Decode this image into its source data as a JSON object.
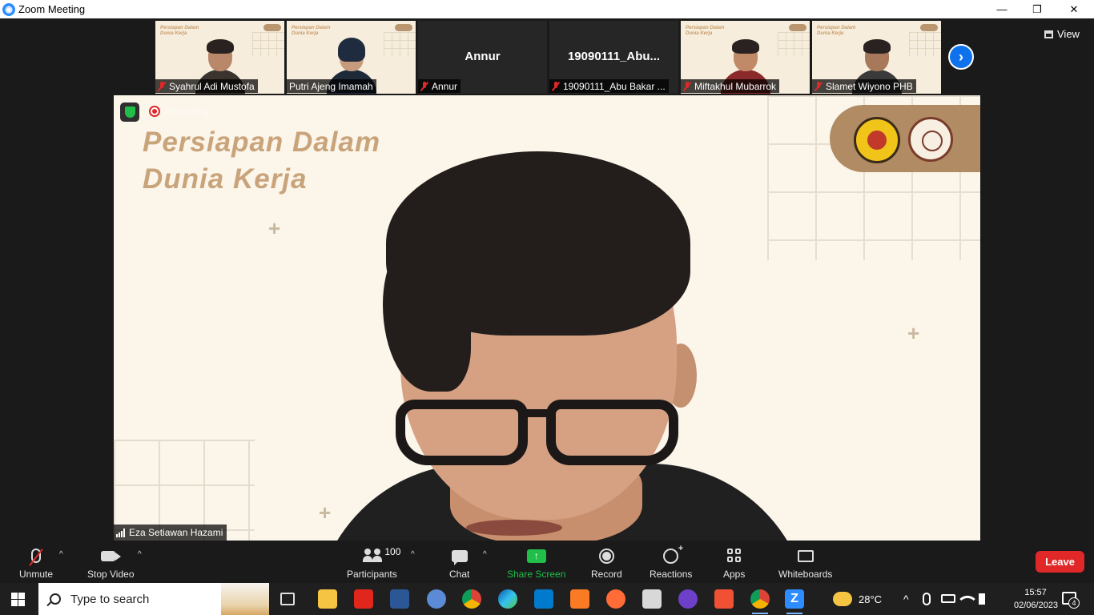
{
  "window": {
    "title": "Zoom Meeting",
    "minimize": "—",
    "restore": "❐",
    "close": "✕"
  },
  "gallery": {
    "tiles": [
      {
        "name": "Syahrul Adi Mustofa",
        "type": "video",
        "slide_text": "Persiapan Dalam\nDunia Kerja"
      },
      {
        "name": "Putri Ajeng Imamah",
        "type": "video",
        "slide_text": "Persiapan Dalam\nDunia Kerja"
      },
      {
        "name": "Annur",
        "type": "avatar",
        "display_name": "Annur"
      },
      {
        "name": "19090111_Abu Bakar ...",
        "type": "avatar",
        "display_name": "19090111_Abu..."
      },
      {
        "name": "Miftakhul Mubarrok",
        "type": "video",
        "slide_text": "Persiapan Dalam\nDunia Kerja"
      },
      {
        "name": "Slamet Wiyono PHB",
        "type": "video",
        "slide_text": "Persiapan Dalam\nDunia Kerja"
      }
    ],
    "next_icon": "›",
    "view_label": "View"
  },
  "speaker": {
    "name": "Eza Setiawan Hazami",
    "slide_title_1": "Persiapan Dalam",
    "slide_title_2": "Dunia Kerja",
    "recording_label": "Recording",
    "plus": "+"
  },
  "toolbar": {
    "unmute": "Unmute",
    "stop_video": "Stop Video",
    "participants": "Participants",
    "participants_count": "100",
    "chat": "Chat",
    "share_screen": "Share Screen",
    "share_icon": "↑",
    "record": "Record",
    "reactions": "Reactions",
    "apps": "Apps",
    "whiteboards": "Whiteboards",
    "leave": "Leave",
    "caret": "^"
  },
  "taskbar": {
    "search_placeholder": "Type to search",
    "weather": "28°C",
    "time": "15:57",
    "date": "02/06/2023",
    "notifications": "4",
    "tray_up": "^",
    "zoom_letter": "Z"
  },
  "colors": {
    "accent": "#2D8CFF",
    "leave": "#E02828",
    "share": "#1FBF4A",
    "slide_bg": "#FBF5EA",
    "slide_title": "#C9A47B"
  }
}
